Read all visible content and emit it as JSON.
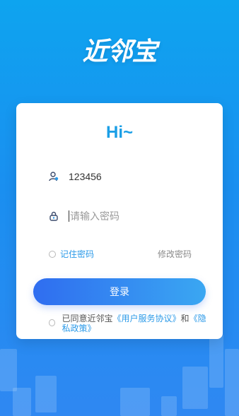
{
  "logo": {
    "text": "近邻宝"
  },
  "card": {
    "greeting": "Hi~",
    "username": {
      "value": "123456",
      "icon": "user-icon"
    },
    "password": {
      "placeholder": "请输入密码",
      "icon": "lock-icon"
    },
    "remember_label": "记住密码",
    "change_password_label": "修改密码",
    "login_label": "登录",
    "agreement": {
      "prefix": "已同意近邻宝",
      "user_agreement": "《用户服务协议》",
      "and": "和",
      "privacy_policy": "《隐私政策》"
    }
  },
  "colors": {
    "accent": "#1b9fe6",
    "button_start": "#2f6df0",
    "button_end": "#3aa7f2",
    "background": "#1a8ff0"
  }
}
